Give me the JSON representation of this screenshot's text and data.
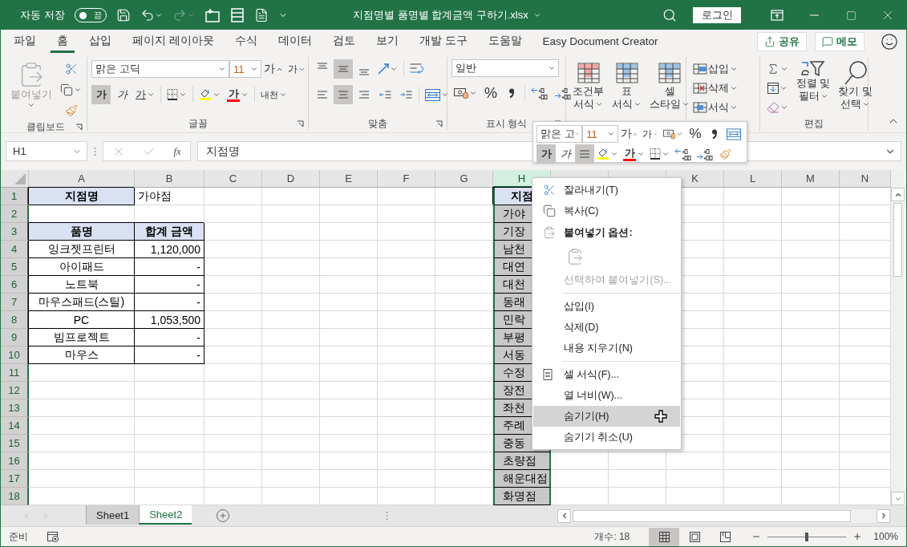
{
  "title_bar": {
    "autosave_label": "자동 저장",
    "autosave_state": "끔",
    "autosave_on": false,
    "title": "지점명별 품명별 합계금액 구하기.xlsx",
    "login": "로그인"
  },
  "ribbon_tabs": [
    {
      "label": "파일",
      "selected": false
    },
    {
      "label": "홈",
      "selected": true
    },
    {
      "label": "삽입",
      "selected": false
    },
    {
      "label": "페이지 레이아웃",
      "selected": false
    },
    {
      "label": "수식",
      "selected": false
    },
    {
      "label": "데이터",
      "selected": false
    },
    {
      "label": "검토",
      "selected": false
    },
    {
      "label": "보기",
      "selected": false
    },
    {
      "label": "개발 도구",
      "selected": false
    },
    {
      "label": "도움말",
      "selected": false
    },
    {
      "label": "Easy Document Creator",
      "selected": false
    }
  ],
  "share_button": "공유",
  "memo_button": "메모",
  "ribbon": {
    "clipboard": {
      "paste": "붙여넣기",
      "paste_disabled": true,
      "label": "클립보드"
    },
    "font": {
      "name": "맑은 고딕",
      "size": "11",
      "grow": "가",
      "shrink": "가",
      "bold": "가",
      "bold_selected": true,
      "italic": "가",
      "underline": "가",
      "font_color": "가",
      "phonetic": "내천",
      "label": "글꼴"
    },
    "alignment": {
      "vertical": [
        {
          "selected": false
        },
        {
          "selected": true
        },
        {
          "selected": false
        }
      ],
      "horizontal": [
        {
          "selected": false
        },
        {
          "selected": true
        },
        {
          "selected": false
        }
      ],
      "label": "맞춤"
    },
    "number": {
      "format": "일반",
      "percent": "%",
      "label": "표시 형식"
    },
    "styles": [
      {
        "line1": "조건부",
        "line2": "서식"
      },
      {
        "line1": "표",
        "line2": "서식"
      },
      {
        "line1": "셀",
        "line2": "스타일"
      }
    ],
    "cells": [
      "삽입",
      "삭제",
      "서식"
    ],
    "editing": {
      "sort": [
        "정렬 및",
        "필터"
      ],
      "find": [
        "찾기 및",
        "선택"
      ],
      "label": "편집"
    }
  },
  "formula_bar": {
    "name_box": "H1",
    "fx_label": "fx",
    "formula": "지점명"
  },
  "columns": [
    {
      "label": "A",
      "selected": false
    },
    {
      "label": "B",
      "selected": false
    },
    {
      "label": "C",
      "selected": false
    },
    {
      "label": "D",
      "selected": false
    },
    {
      "label": "E",
      "selected": false
    },
    {
      "label": "F",
      "selected": false
    },
    {
      "label": "G",
      "selected": false
    },
    {
      "label": "H",
      "selected": true
    },
    {
      "selected": false
    },
    {
      "selected": false
    },
    {
      "label": "K",
      "selected": false
    },
    {
      "label": "L",
      "selected": false
    },
    {
      "label": "M",
      "selected": false
    },
    {
      "label": "N",
      "selected": false
    }
  ],
  "rows": [
    {
      "number": "1",
      "a": {
        "text": "지점명",
        "kind": "header"
      },
      "b": {
        "text": "가야점",
        "kind": "plain"
      },
      "h": {
        "text": "지점",
        "kind": "header"
      }
    },
    {
      "number": "2",
      "h": {
        "text": "가야",
        "kind": "list"
      }
    },
    {
      "number": "3",
      "a": {
        "text": "품명",
        "kind": "header"
      },
      "b": {
        "text": "합계 금액",
        "kind": "header"
      },
      "h": {
        "text": "기장",
        "kind": "list"
      }
    },
    {
      "number": "4",
      "a": {
        "text": "잉크젯프린터",
        "kind": "item"
      },
      "b": {
        "text": "1,120,000",
        "kind": "amount"
      },
      "h": {
        "text": "남천",
        "kind": "list"
      }
    },
    {
      "number": "5",
      "a": {
        "text": "아이패드",
        "kind": "item"
      },
      "b": {
        "text": "-",
        "kind": "amount"
      },
      "h": {
        "text": "대연",
        "kind": "list"
      }
    },
    {
      "number": "6",
      "a": {
        "text": "노트북",
        "kind": "item"
      },
      "b": {
        "text": "-",
        "kind": "amount"
      },
      "h": {
        "text": "대천",
        "kind": "list"
      }
    },
    {
      "number": "7",
      "a": {
        "text": "마우스패드(스틸)",
        "kind": "item"
      },
      "b": {
        "text": "-",
        "kind": "amount"
      },
      "h": {
        "text": "동래",
        "kind": "list"
      }
    },
    {
      "number": "8",
      "a": {
        "text": "PC",
        "kind": "item"
      },
      "b": {
        "text": "1,053,500",
        "kind": "amount"
      },
      "h": {
        "text": "민락",
        "kind": "list"
      }
    },
    {
      "number": "9",
      "a": {
        "text": "빔프로젝트",
        "kind": "item"
      },
      "b": {
        "text": "-",
        "kind": "amount"
      },
      "h": {
        "text": "부평",
        "kind": "list"
      }
    },
    {
      "number": "10",
      "a": {
        "text": "마우스",
        "kind": "item"
      },
      "b": {
        "text": "-",
        "kind": "amount"
      },
      "h": {
        "text": "서동",
        "kind": "list"
      }
    },
    {
      "number": "11",
      "h": {
        "text": "수정",
        "kind": "list"
      }
    },
    {
      "number": "12",
      "h": {
        "text": "장전",
        "kind": "list"
      }
    },
    {
      "number": "13",
      "h": {
        "text": "좌천",
        "kind": "list"
      }
    },
    {
      "number": "14",
      "h": {
        "text": "주례",
        "kind": "list"
      }
    },
    {
      "number": "15",
      "h": {
        "text": "중동",
        "kind": "list"
      }
    },
    {
      "number": "16",
      "h": {
        "text": "초량점",
        "kind": "list"
      }
    },
    {
      "number": "17",
      "h": {
        "text": "해운대점",
        "kind": "list"
      }
    },
    {
      "number": "18",
      "h": {
        "text": "화명점",
        "kind": "list"
      }
    }
  ],
  "context_menu": [
    {
      "kind": "cut",
      "label": "잘라내기(T)",
      "selected": false,
      "disabled": false
    },
    {
      "kind": "copy",
      "label": "복사(C)",
      "selected": false,
      "disabled": false
    },
    {
      "kind": "heading",
      "label": "붙여넣기 옵션:",
      "selected": false,
      "disabled": false
    },
    {
      "kind": "paste-options"
    },
    {
      "kind": "command",
      "label": "선택하여 붙여넣기(S)...",
      "selected": false,
      "disabled": true
    },
    {
      "kind": "separator"
    },
    {
      "kind": "command",
      "label": "삽입(I)",
      "selected": false,
      "disabled": false
    },
    {
      "kind": "command",
      "label": "삭제(D)",
      "selected": false,
      "disabled": false
    },
    {
      "kind": "command",
      "label": "내용 지우기(N)",
      "selected": false,
      "disabled": false
    },
    {
      "kind": "separator"
    },
    {
      "kind": "format",
      "label": "셀 서식(F)...",
      "selected": false,
      "disabled": false
    },
    {
      "kind": "command",
      "label": "열 너비(W)...",
      "selected": false,
      "disabled": false
    },
    {
      "kind": "command",
      "label": "숨기기(H)",
      "selected": true,
      "disabled": false
    },
    {
      "kind": "command",
      "label": "숨기기 취소(U)",
      "selected": false,
      "disabled": false
    }
  ],
  "mini_toolbar": {
    "font": "맑은 고",
    "size": "11",
    "grow": "가",
    "shrink": "가",
    "percent": "%",
    "bold": "가",
    "bold_selected": true,
    "italic": "가",
    "center_selected": true,
    "font_color": "가"
  },
  "sheet_tabs": [
    {
      "label": "Sheet1",
      "selected": false
    },
    {
      "label": "Sheet2",
      "selected": true
    }
  ],
  "status_bar": {
    "mode": "준비",
    "count": "개수: 18",
    "views": [
      {
        "selected": true
      },
      {
        "selected": false
      },
      {
        "selected": false
      }
    ],
    "zoom_slider": {
      "level": 0.5
    },
    "zoom": "100%"
  }
}
